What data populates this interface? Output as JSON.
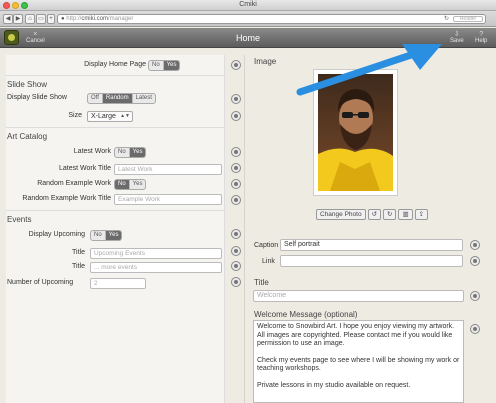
{
  "window": {
    "title": "Cmiki"
  },
  "browser": {
    "url_domain": "cmiki.com",
    "url_path": "/manager",
    "reader_label": "Reader"
  },
  "header": {
    "cancel_label": "Cancel",
    "title": "Home",
    "save_label": "Save",
    "help_label": "Help"
  },
  "left": {
    "home_page": {
      "label": "Display Home Page",
      "options": [
        "No",
        "Yes"
      ],
      "selected": "Yes"
    },
    "slideshow": {
      "title": "Slide Show",
      "display": {
        "label": "Display Slide Show",
        "options": [
          "Off",
          "Random",
          "Latest"
        ],
        "selected": "Random"
      },
      "size": {
        "label": "Size",
        "value": "X-Large"
      }
    },
    "catalog": {
      "title": "Art Catalog",
      "latest_work": {
        "label": "Latest Work",
        "options": [
          "No",
          "Yes"
        ],
        "selected": "Yes"
      },
      "latest_title": {
        "label": "Latest Work Title",
        "placeholder": "Latest Work"
      },
      "random_work": {
        "label": "Random Example Work",
        "options": [
          "No",
          "Yes"
        ],
        "selected": "No"
      },
      "random_title": {
        "label": "Random Example Work Title",
        "placeholder": "Example Work"
      }
    },
    "events": {
      "title": "Events",
      "display": {
        "label": "Display Upcoming",
        "options": [
          "No",
          "Yes"
        ],
        "selected": "Yes"
      },
      "title1": {
        "label": "Title",
        "placeholder": "Upcoming Events"
      },
      "title2": {
        "label": "Title",
        "placeholder": "... more events"
      },
      "number": {
        "label": "Number of Upcoming",
        "value": "2"
      }
    }
  },
  "right": {
    "image_title": "Image",
    "photo_buttons": {
      "change": "Change Photo"
    },
    "caption": {
      "label": "Caption",
      "value": "Self portrait"
    },
    "link": {
      "label": "Link",
      "value": ""
    },
    "title_section": "Title",
    "title_placeholder": "Welcome",
    "welcome_section": "Welcome Message (optional)",
    "welcome_paragraphs": [
      "Welcome to Snowbird Art. I hope you enjoy viewing my artwork. All images are copyrighted. Please contact me if you would like permission to use an image.",
      "Check my events page to see where I will be showing my work or teaching workshops.",
      "Private lessons in my studio available on request."
    ]
  },
  "colors": {
    "arrow": "#2a8fe0",
    "header": "#6e6e6e",
    "background": "#eeebe3",
    "logo": "#4c5a1e"
  }
}
